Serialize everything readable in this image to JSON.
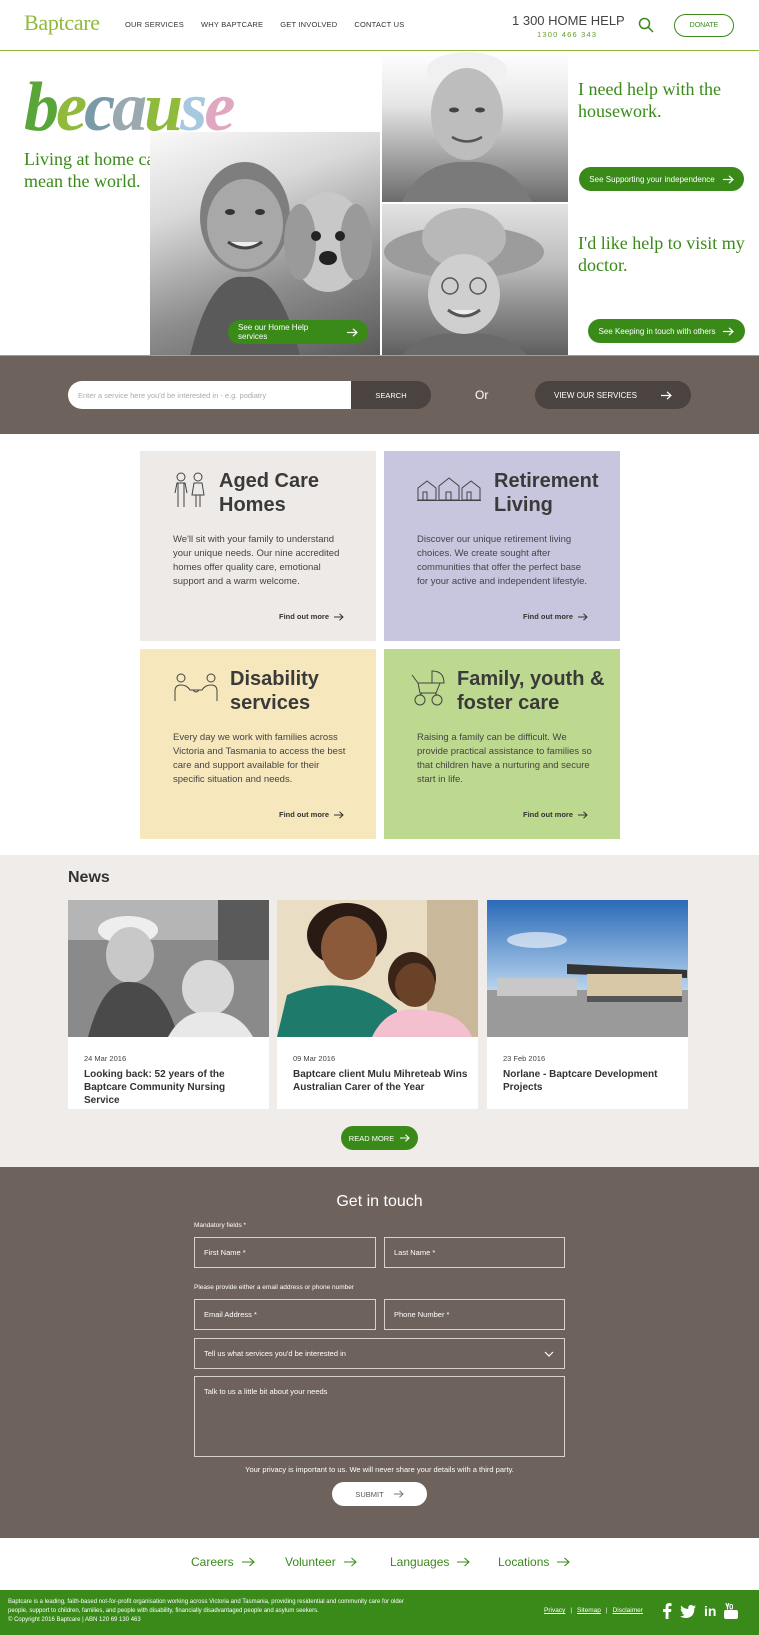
{
  "header": {
    "logo": "Baptcare",
    "nav": [
      "OUR SERVICES",
      "WHY BAPTCARE",
      "GET INVOLVED",
      "CONTACT US"
    ],
    "phone": "1 300 HOME HELP",
    "phone_number": "1300 466 343",
    "donate": "DONATE"
  },
  "hero": {
    "headline": "because",
    "tagline": "Living at home can mean the world.",
    "quote1": "I need help with the housework.",
    "button1": "See Supporting your independence",
    "quote2": "I'd like help to visit my doctor.",
    "button2": "See Keeping in touch with others",
    "button_main": "See our Home Help services"
  },
  "search": {
    "placeholder": "Enter a service here you'd be interested in - e.g. podiatry",
    "button": "SEARCH",
    "or": "Or",
    "view_services": "VIEW OUR SERVICES"
  },
  "cards": [
    {
      "title": "Aged Care Homes",
      "body": "We'll sit with your family to understand your unique needs. Our nine accredited homes offer quality care, emotional support and a warm welcome.",
      "more": "Find out more",
      "color": "#eeeae8",
      "icon": "people-icon"
    },
    {
      "title": "Retirement Living",
      "body": "Discover our unique retirement living choices. We create sought after communities that offer the perfect base for your active and independent lifestyle.",
      "more": "Find out more",
      "color": "#c8c5df",
      "icon": "houses-icon"
    },
    {
      "title": "Disability services",
      "body": "Every day we work with families across Victoria and Tasmania to access the best care and support available for their specific situation and needs.",
      "more": "Find out more",
      "color": "#f6e7bd",
      "icon": "helping-hand-icon"
    },
    {
      "title": "Family, youth & foster care",
      "body": "Raising a family can be difficult. We provide practical assistance to families so that children have a nurturing and secure start in life.",
      "more": "Find out more",
      "color": "#bdd88f",
      "icon": "stroller-icon"
    }
  ],
  "news": {
    "heading": "News",
    "items": [
      {
        "date": "24 Mar 2016",
        "title": "Looking back: 52 years of the Baptcare Community Nursing Service"
      },
      {
        "date": "09 Mar 2016",
        "title": "Baptcare client Mulu Mihreteab Wins Australian Carer of the Year"
      },
      {
        "date": "23 Feb 2016",
        "title": "Norlane - Baptcare Development Projects"
      }
    ],
    "read_more": "READ MORE"
  },
  "contact": {
    "heading": "Get in touch",
    "mandatory": "Mandatory fields *",
    "first_name": "First Name *",
    "last_name": "Last Name *",
    "either_note": "Please provide either a email address or phone number",
    "email": "Email Address *",
    "phone": "Phone Number *",
    "services_select": "Tell us what services you'd be interested in",
    "needs": "Talk to us a little bit about your needs",
    "privacy": "Your privacy is important to us. We will never share your details with a third party.",
    "submit": "SUBMIT"
  },
  "bottom_links": [
    "Careers",
    "Volunteer",
    "Languages",
    "Locations"
  ],
  "footer": {
    "about": "Baptcare is a leading, faith-based not-for-profit organisation working across Victoria and Tasmania, providing residential and community care for older people, support to children, families, and people with disability, financially disadvantaged people and asylum seekers.",
    "copyright": "© Copyright 2016 Baptcare | ABN 120 69 130 463",
    "links": [
      "Privacy",
      "Sitemap",
      "Disclaimer"
    ],
    "social": [
      "facebook-icon",
      "twitter-icon",
      "linkedin-icon",
      "youtube-icon"
    ]
  },
  "colors": {
    "brand_green": "#3a8a1a",
    "light_green": "#8fba3c",
    "band_brown": "#6e625c"
  }
}
